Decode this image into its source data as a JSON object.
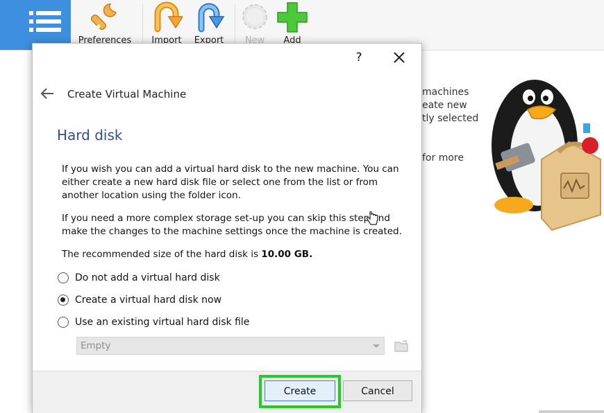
{
  "toolbar": {
    "buttons": [
      {
        "label": "Preferences"
      },
      {
        "label": "Import"
      },
      {
        "label": "Export"
      },
      {
        "label": "New",
        "disabled": true
      },
      {
        "label": "Add"
      }
    ]
  },
  "background_text": {
    "lines": [
      "machines",
      "eate new",
      "tly selected",
      "for more"
    ]
  },
  "dialog": {
    "help_label": "?",
    "wizard_title": "Create Virtual Machine",
    "page_title": "Hard disk",
    "para1": "If you wish you can add a virtual hard disk to the new machine. You can either create a new hard disk file or select one from the list or from another location using the folder icon.",
    "para2": "If you need a more complex storage set-up you can skip this step and make the changes to the machine settings once the machine is created.",
    "recommended_prefix": "The recommended size of the hard disk is ",
    "recommended_size": "10.00 GB.",
    "options": [
      {
        "label": "Do not add a virtual hard disk",
        "checked": false
      },
      {
        "label": "Create a virtual hard disk now",
        "checked": true
      },
      {
        "label": "Use an existing virtual hard disk file",
        "checked": false
      }
    ],
    "existing_disk_select": "Empty",
    "create_label": "Create",
    "cancel_label": "Cancel"
  },
  "colors": {
    "accent_blue": "#3f8fe0",
    "highlight_green": "#20d020",
    "title_blue": "#2f4f8a"
  }
}
